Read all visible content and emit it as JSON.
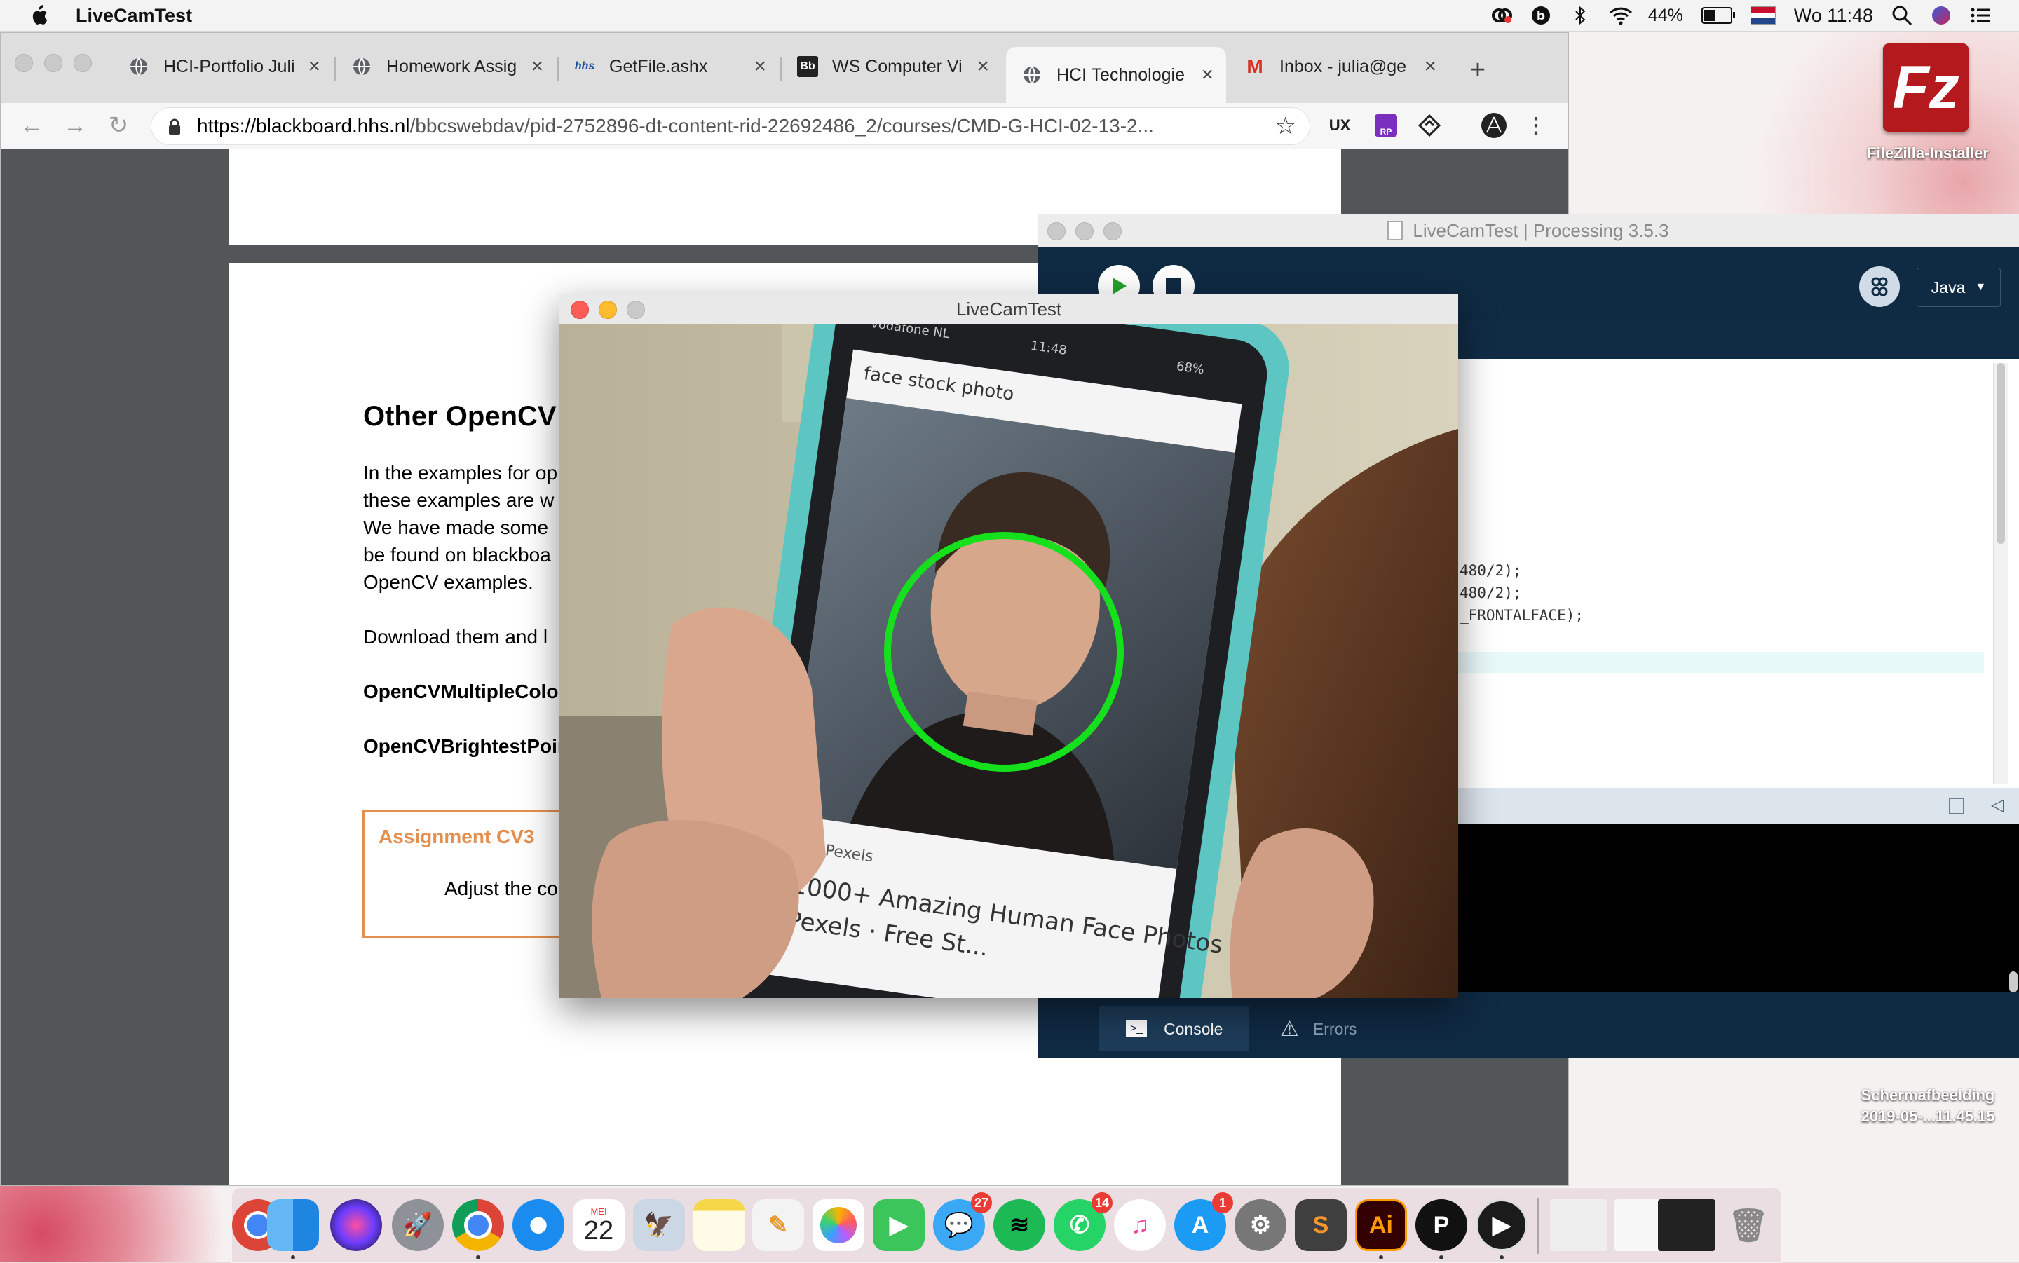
{
  "menubar": {
    "app_name": "LiveCamTest",
    "battery": "44%",
    "clock": "Wo 11:48"
  },
  "browser": {
    "tabs": [
      {
        "label": "HCI-Portfolio Juli",
        "icon": "globe-icon"
      },
      {
        "label": "Homework Assig",
        "icon": "globe-icon"
      },
      {
        "label": "GetFile.ashx",
        "icon": "hhs-icon"
      },
      {
        "label": "WS Computer Vi",
        "icon": "blackboard-icon"
      },
      {
        "label": "HCI Technologie",
        "icon": "globe-icon"
      },
      {
        "label": "Inbox - julia@ge",
        "icon": "gmail-icon"
      }
    ],
    "url_host": "https://blackboard.hhs.nl",
    "url_path": "/bbcswebdav/pid-2752896-dt-content-rid-22692486_2/courses/CMD-G-HCI-02-13-2...",
    "extensions": [
      "UX",
      "RP"
    ]
  },
  "pdf": {
    "heading": "Other OpenCV",
    "para": [
      "In the examples for op",
      "these examples are w",
      "We have made some",
      "be found on blackboa",
      "OpenCV examples."
    ],
    "download": "Download them and l",
    "file1": "OpenCVMultipleColo",
    "file2": "OpenCVBrightestPoin",
    "assignment_title": "Assignment CV3",
    "assignment_text": "Adjust the co"
  },
  "processing": {
    "title": "LiveCamTest | Processing 3.5.3",
    "mode": "Java",
    "code": [
      "480/2);",
      "480/2);",
      "_FRONTALFACE);"
    ],
    "console_tab": "Console",
    "errors_tab": "Errors"
  },
  "livecam": {
    "title": "LiveCamTest",
    "phone_status_carrier": "vodafone NL",
    "phone_status_time": "11:48",
    "phone_status_battery": "68%",
    "phone_search": "face stock photo",
    "phone_source": "Pexels",
    "phone_result": "1000+ Amazing Human Face Photos",
    "phone_result2": "Pexels · Free St..."
  },
  "desktop": {
    "icon1_label": "FileZilla-Installer",
    "icon2_label_line1": "Schermafbeelding",
    "icon2_label_line2": "2019-05-...11.45.15"
  },
  "dock": {
    "calendar_month": "MEI",
    "calendar_day": "22",
    "messages_badge": "27",
    "whatsapp_badge": "14",
    "appstore_badge": "1",
    "illustrator_label": "Ai"
  }
}
